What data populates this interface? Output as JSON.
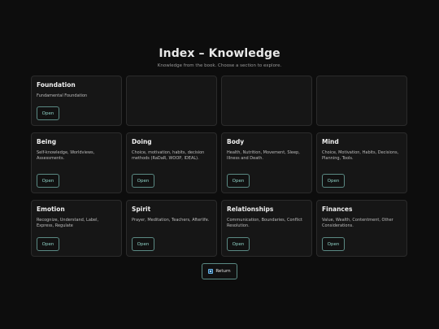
{
  "header": {
    "title": "Index – Knowledge",
    "subtitle": "Knowledge from the book. Choose a section to explore."
  },
  "cards": [
    {
      "title": "Foundation",
      "desc": "Fundamental Foundation",
      "button": "Open"
    },
    {
      "title": "",
      "desc": "",
      "button": ""
    },
    {
      "title": "",
      "desc": "",
      "button": ""
    },
    {
      "title": "",
      "desc": "",
      "button": ""
    },
    {
      "title": "Being",
      "desc": "Self-knowledge, Worldviews, Assessments.",
      "button": "Open"
    },
    {
      "title": "Doing",
      "desc": "Choice, motivation, habits, decision methods (RaDaR, WOOP, IDEAL).",
      "button": "Open"
    },
    {
      "title": "Body",
      "desc": "Health, Nutrition, Movement, Sleep, Illness and Death.",
      "button": "Open"
    },
    {
      "title": "Mind",
      "desc": "Choice, Motivation, Habits, Decisions, Planning, Tools.",
      "button": "Open"
    },
    {
      "title": "Emotion",
      "desc": "Recognize, Understand, Label, Express, Regulate",
      "button": "Open"
    },
    {
      "title": "Spirit",
      "desc": "Prayer, Meditation, Teachers, Afterlife.",
      "button": "Open"
    },
    {
      "title": "Relationships",
      "desc": "Communication, Boundaries, Conflict Resolution.",
      "button": "Open"
    },
    {
      "title": "Finances",
      "desc": "Value, Wealth, Contentment, Other Considerations.",
      "button": "Open"
    }
  ],
  "footer": {
    "return_label": "Return",
    "return_icon": "return-icon"
  },
  "colors": {
    "background": "#0d0d0d",
    "card": "#161616",
    "accent": "#8fd3c8"
  }
}
